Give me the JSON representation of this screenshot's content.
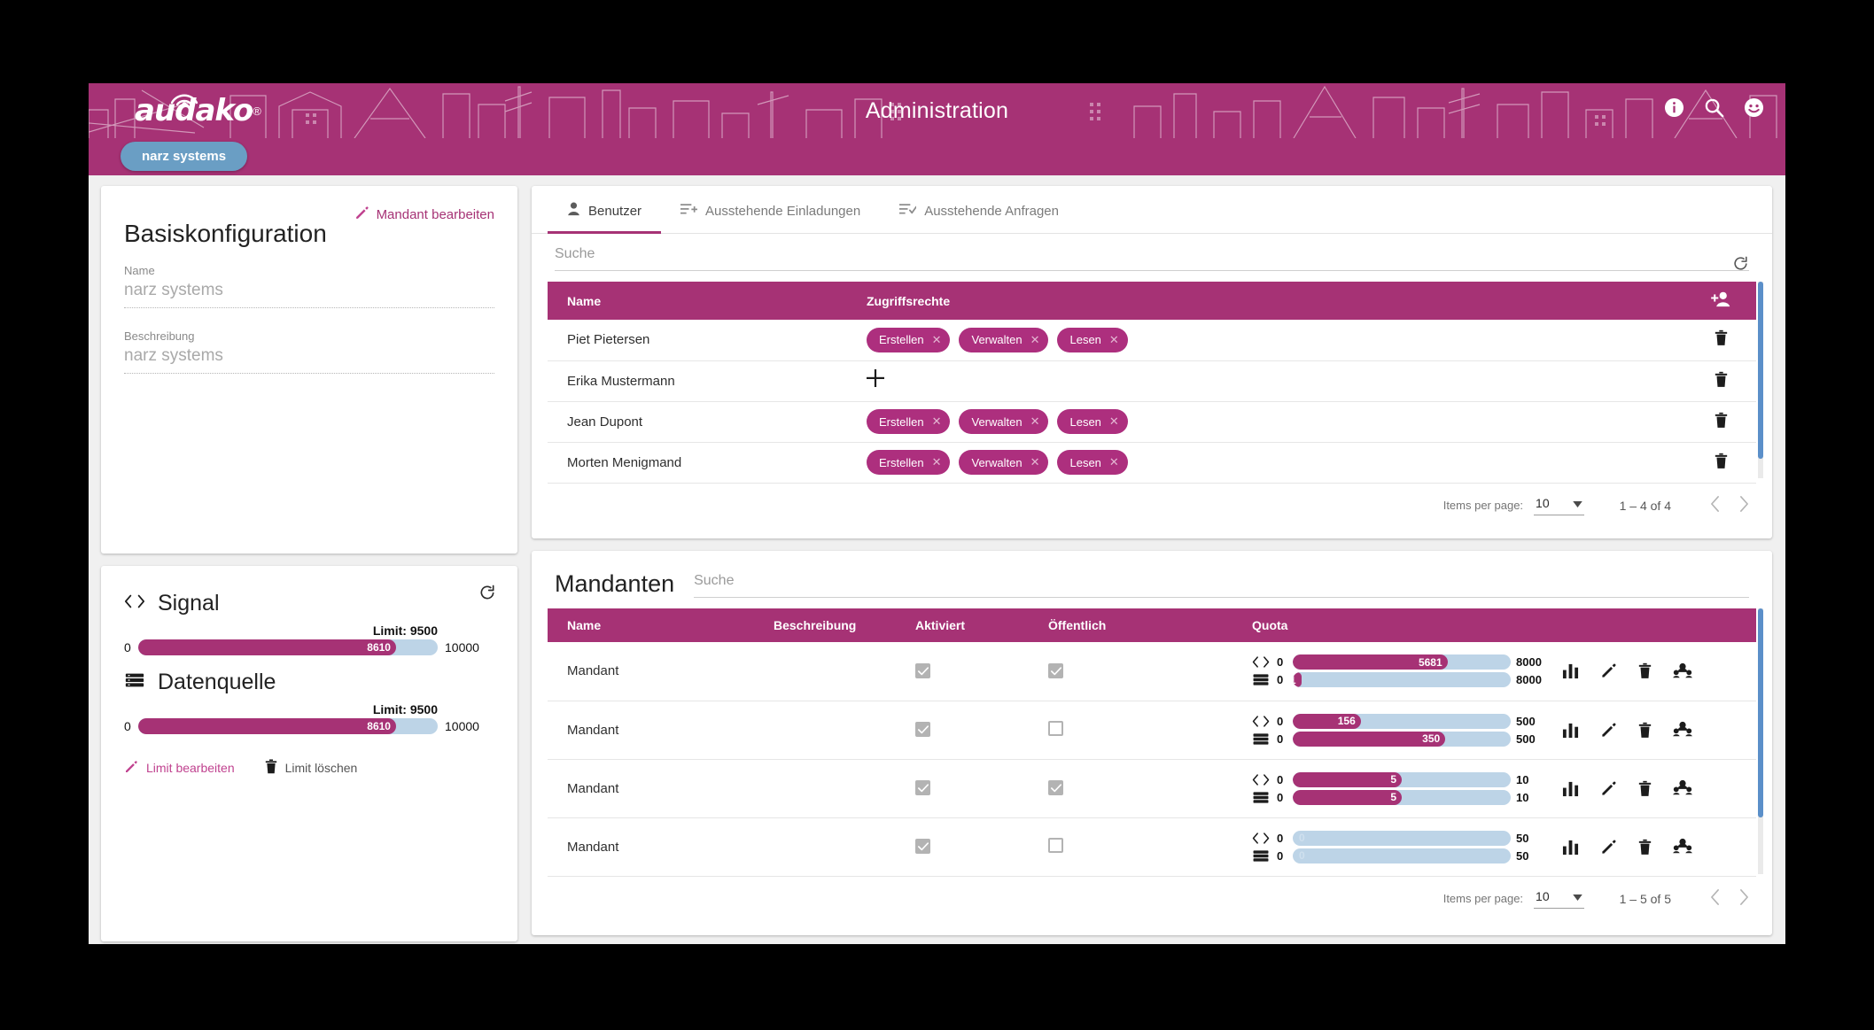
{
  "header": {
    "logo_text": "audako",
    "logo_reg": "®",
    "title": "Administration",
    "icons": [
      "info-icon",
      "search-icon",
      "account-face-icon"
    ],
    "tenant_chip": "narz systems"
  },
  "basis": {
    "edit_link": "Mandant bearbeiten",
    "title": "Basiskonfiguration",
    "fields": [
      {
        "label": "Name",
        "value": "narz systems"
      },
      {
        "label": "Beschreibung",
        "value": "narz systems"
      }
    ]
  },
  "quota_panel": {
    "groups": [
      {
        "icon": "code-brackets-icon",
        "title": "Signal",
        "limit_label": "Limit: 9500",
        "min": "0",
        "value": "8610",
        "max": "10000",
        "percent": 86.1
      },
      {
        "icon": "database-icon",
        "title": "Datenquelle",
        "limit_label": "Limit: 9500",
        "min": "0",
        "value": "8610",
        "max": "10000",
        "percent": 86.1
      }
    ],
    "actions": [
      {
        "icon": "pencil-icon",
        "label": "Limit bearbeiten"
      },
      {
        "icon": "trash-icon",
        "label": "Limit löschen"
      }
    ]
  },
  "users": {
    "tabs": [
      {
        "label": "Benutzer",
        "icon": "person-icon",
        "active": true
      },
      {
        "label": "Ausstehende Einladungen",
        "icon": "list-plus-icon",
        "active": false
      },
      {
        "label": "Ausstehende Anfragen",
        "icon": "list-check-icon",
        "active": false
      }
    ],
    "search_placeholder": "Suche",
    "columns": [
      "Name",
      "Zugriffsrechte",
      ""
    ],
    "rows": [
      {
        "name": "Piet Pietersen",
        "rights": [
          "Erstellen",
          "Verwalten",
          "Lesen"
        ]
      },
      {
        "name": "Erika Mustermann",
        "rights": []
      },
      {
        "name": "Jean Dupont",
        "rights": [
          "Erstellen",
          "Verwalten",
          "Lesen"
        ]
      },
      {
        "name": "Morten Menigmand",
        "rights": [
          "Erstellen",
          "Verwalten",
          "Lesen"
        ]
      }
    ],
    "paginator": {
      "items_per_page_label": "Items per page:",
      "items_per_page_value": "10",
      "range": "1 – 4 of 4"
    }
  },
  "mandanten": {
    "title": "Mandanten",
    "search_placeholder": "Suche",
    "columns": [
      "Name",
      "Beschreibung",
      "Aktiviert",
      "Öffentlich",
      "Quota"
    ],
    "rows": [
      {
        "name": "Mandant",
        "beschreibung": "",
        "aktiviert": true,
        "oeffentlich": true,
        "quota": [
          {
            "icon": "code-brackets-icon",
            "min": "0",
            "value": "5681",
            "max": "8000",
            "percent": 71.0
          },
          {
            "icon": "database-icon",
            "min": "0",
            "value": "311",
            "max": "8000",
            "percent": 3.9
          }
        ]
      },
      {
        "name": "Mandant",
        "beschreibung": "",
        "aktiviert": true,
        "oeffentlich": false,
        "quota": [
          {
            "icon": "code-brackets-icon",
            "min": "0",
            "value": "156",
            "max": "500",
            "percent": 31.2
          },
          {
            "icon": "database-icon",
            "min": "0",
            "value": "350",
            "max": "500",
            "percent": 70.0
          }
        ]
      },
      {
        "name": "Mandant",
        "beschreibung": "",
        "aktiviert": true,
        "oeffentlich": true,
        "quota": [
          {
            "icon": "code-brackets-icon",
            "min": "0",
            "value": "5",
            "max": "10",
            "percent": 50.0
          },
          {
            "icon": "database-icon",
            "min": "0",
            "value": "5",
            "max": "10",
            "percent": 50.0
          }
        ]
      },
      {
        "name": "Mandant",
        "beschreibung": "",
        "aktiviert": true,
        "oeffentlich": false,
        "quota": [
          {
            "icon": "code-brackets-icon",
            "min": "0",
            "value": "0",
            "max": "50",
            "percent": 0
          },
          {
            "icon": "database-icon",
            "min": "0",
            "value": "0",
            "max": "50",
            "percent": 0
          }
        ]
      }
    ],
    "row_actions": [
      "chart-icon",
      "pencil-icon",
      "trash-icon",
      "group-users-icon"
    ],
    "paginator": {
      "items_per_page_label": "Items per page:",
      "items_per_page_value": "10",
      "range": "1 – 5 of 5"
    }
  },
  "colors": {
    "brand": "#a63275",
    "chip": "#ad2f7e",
    "tenant_chip": "#6a9ec4",
    "bar_track": "#bdd4e7",
    "scrollbar": "#5b8fc9"
  }
}
